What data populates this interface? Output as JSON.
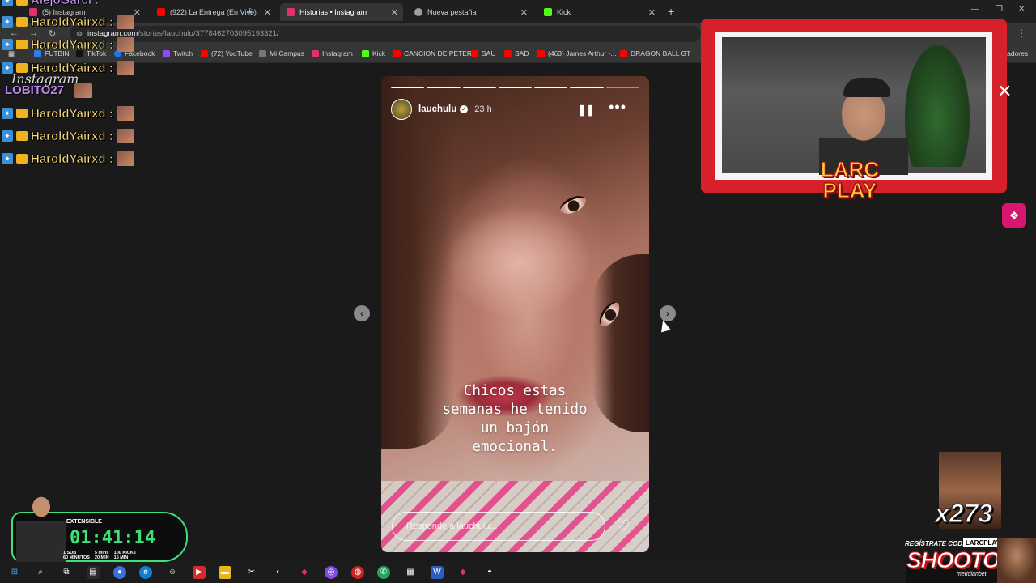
{
  "browser": {
    "tabs": [
      {
        "label": "(5) Instagram",
        "color": "#e1306c",
        "active": false
      },
      {
        "label": "(922) La Entrega (En Vivo)",
        "color": "#ff0000",
        "active": false
      },
      {
        "label": "Historias • Instagram",
        "color": "#e1306c",
        "active": true
      },
      {
        "label": "Nueva pestaña",
        "color": "#9aa0a6",
        "active": false
      },
      {
        "label": "Kick",
        "color": "#53fc18",
        "active": false
      }
    ],
    "url_host": "instagram.com",
    "url_path": "/stories/lauchulu/3778462703095193321/",
    "bookmarks": [
      {
        "label": "FUTBIN",
        "color": "#2b7de9"
      },
      {
        "label": "TikTok",
        "color": "#111111"
      },
      {
        "label": "Facebook",
        "color": "#1877f2"
      },
      {
        "label": "Twitch",
        "color": "#9146ff"
      },
      {
        "label": "(72) YouTube",
        "color": "#ff0000"
      },
      {
        "label": "Mi Campus",
        "color": "#777777"
      },
      {
        "label": "Instagram",
        "color": "#e1306c"
      },
      {
        "label": "Kick",
        "color": "#53fc18"
      },
      {
        "label": "CANCION DE PETER",
        "color": "#ff0000"
      },
      {
        "label": "SAU",
        "color": "#ff0000"
      },
      {
        "label": "SAD",
        "color": "#ff0000"
      },
      {
        "label": "(463) James Arthur -...",
        "color": "#ff0000"
      },
      {
        "label": "DRAGON BALL GT",
        "color": "#ff0000"
      }
    ],
    "bookmarks_more": "rcadores"
  },
  "story": {
    "username": "lauchulu",
    "age": "23 h",
    "caption": "Chicos estas\nsemanas he tenido\nun bajón\nemocional.",
    "reply_placeholder": "Responde a lauchulu...",
    "segments_total": 7,
    "segments_done": 6
  },
  "chat": {
    "top_cut": "AlejoGarci :",
    "lines": [
      "HaroldYairxd :",
      "HaroldYairxd :",
      "HaroldYairxd :",
      "HaroldYairxd :",
      "HaroldYairxd :",
      "HaroldYairxd :"
    ],
    "purple": "LOBITO27",
    "script": "Instagram"
  },
  "stream": {
    "logo_line1": "LARC",
    "logo_line2": "PLAY",
    "counter": "x273",
    "sponsor_register": "REGÍSTRATE COD:",
    "sponsor_code": "LARCPLAY",
    "sponsor_name": "SHOOTOUT",
    "sponsor_sub": "meridianbet",
    "timer_label": "EXTENSIBLE",
    "timer": "01:41:14",
    "timer_rules": [
      "1 SUB\n60 MINUTOS",
      "5 mins\n20 MIN",
      "100 KICKs\n15 MIN"
    ]
  },
  "icons": {
    "pause": "pause-icon",
    "more": "more-icon",
    "heart": "heart-icon",
    "prev": "chevron-left-icon",
    "next": "chevron-right-icon"
  }
}
